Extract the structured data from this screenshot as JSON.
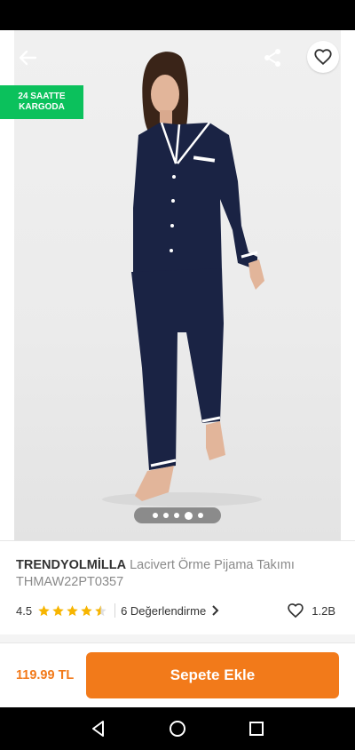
{
  "badge": {
    "line1": "24 SAATTE",
    "line2": "KARGODA"
  },
  "gallery": {
    "image_count": 5,
    "active_index": 3
  },
  "product": {
    "brand": "TRENDYOLMİLLA",
    "name": "Lacivert Örme Pijama Takımı",
    "code": "THMAW22PT0357",
    "rating": "4.5",
    "rating_value": 4.5,
    "reviews_label": "6 Değerlendirme",
    "favorites": "1.2B"
  },
  "purchase": {
    "price": "119.99 TL",
    "add_to_cart": "Sepete Ekle"
  },
  "colors": {
    "brand_orange": "#f27a1a",
    "badge_green": "#0bc15c",
    "star": "#f7b500"
  },
  "icons": [
    "back-arrow-icon",
    "share-icon",
    "heart-icon",
    "star-icon",
    "chevron-right-icon",
    "nav-back-icon",
    "nav-home-icon",
    "nav-recents-icon"
  ]
}
